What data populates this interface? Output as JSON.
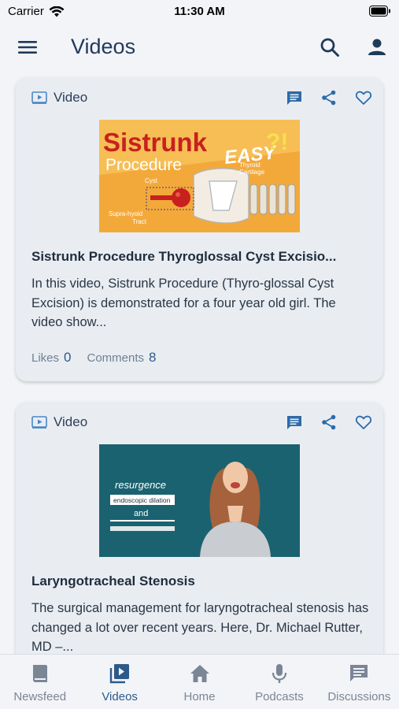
{
  "status_bar": {
    "carrier": "Carrier",
    "time": "11:30 AM"
  },
  "header": {
    "title": "Videos"
  },
  "cards": [
    {
      "type_label": "Video",
      "thumbnail": {
        "line1": "Sistrunk",
        "line2": "Procedure",
        "badge": "EASY",
        "badge_mark": "?!",
        "cyst": "Cyst",
        "thyroid": "Thyroid",
        "cartilage": "Cartilage",
        "supra1": "Supra-hyoid",
        "supra2": "Tract"
      },
      "title": "Sistrunk Procedure Thyroglossal Cyst Excisio...",
      "description": "In this video, Sistrunk Procedure (Thyro-glossal Cyst Excision) is demonstrated for a four year old girl. The video show...",
      "likes_label": "Likes",
      "likes_count": "0",
      "comments_label": "Comments",
      "comments_count": "8"
    },
    {
      "type_label": "Video",
      "thumbnail": {
        "line1": "resurgence",
        "line2": "endoscopic dilation",
        "line3": "and"
      },
      "title": "Laryngotracheal Stenosis",
      "description": "The surgical management for laryngotracheal stenosis has changed a lot over recent years. Here, Dr. Michael Rutter, MD –..."
    }
  ],
  "tabs": [
    {
      "label": "Newsfeed",
      "icon": "book-icon"
    },
    {
      "label": "Videos",
      "icon": "video-library-icon",
      "active": true
    },
    {
      "label": "Home",
      "icon": "home-icon"
    },
    {
      "label": "Podcasts",
      "icon": "microphone-icon"
    },
    {
      "label": "Discussions",
      "icon": "chat-icon"
    }
  ],
  "colors": {
    "accent": "#2d5a8a",
    "background": "#f3f4f7",
    "card": "#e9edf2",
    "inactive_tab": "#7a8696"
  }
}
